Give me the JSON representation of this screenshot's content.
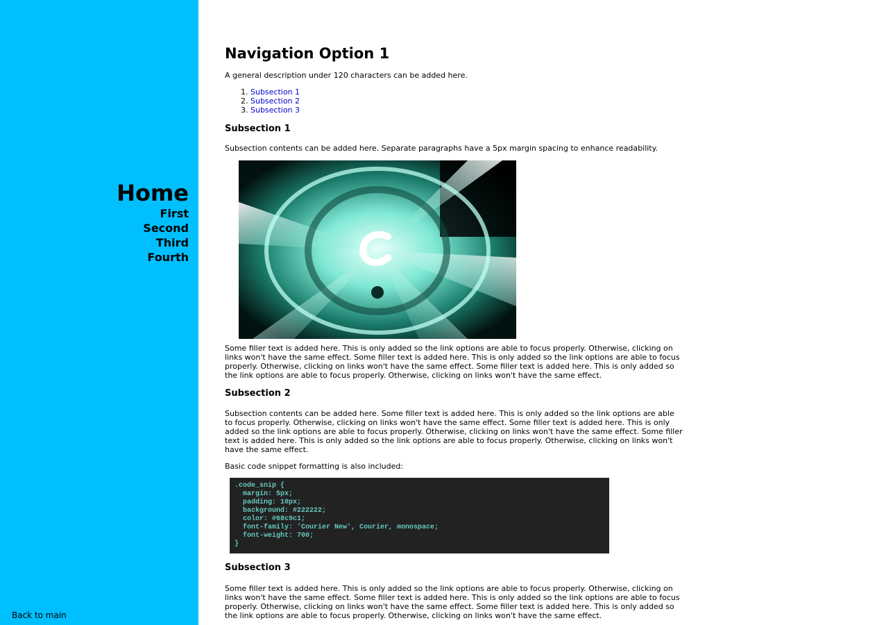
{
  "sidebar": {
    "home": "Home",
    "items": [
      "First",
      "Second",
      "Third",
      "Fourth"
    ],
    "back": "Back to main",
    "bg": "#00bfff"
  },
  "main": {
    "title": "Navigation Option 1",
    "description": "A general description under 120 characters can be added here.",
    "toc": [
      "Subsection 1",
      "Subsection 2",
      "Subsection 3"
    ],
    "sections": [
      {
        "heading": "Subsection 1",
        "intro": "Subsection contents can be added here. Separate paragraphs have a 5px margin spacing to enhance readability.",
        "filler": "Some filler text is added here. This is only added so the link options are able to focus properly. Otherwise, clicking on links won't have the same effect. Some filler text is added here. This is only added so the link options are able to focus properly. Otherwise, clicking on links won't have the same effect. Some filler text is added here. This is only added so the link options are able to focus properly. Otherwise, clicking on links won't have the same effect."
      },
      {
        "heading": "Subsection 2",
        "intro": "Subsection contents can be added here. Some filler text is added here. This is only added so the link options are able to focus properly. Otherwise, clicking on links won't have the same effect. Some filler text is added here. This is only added so the link options are able to focus properly. Otherwise, clicking on links won't have the same effect. Some filler text is added here. This is only added so the link options are able to focus properly. Otherwise, clicking on links won't have the same effect.",
        "code_label": "Basic code snippet formatting is also included:",
        "code": ".code_snip {\n  margin: 5px;\n  padding: 10px;\n  background: #222222;\n  color: #68c9c1;\n  font-family: 'Courier New', Courier, monospace;\n  font-weight: 700;\n}"
      },
      {
        "heading": "Subsection 3",
        "filler": "Some filler text is added here. This is only added so the link options are able to focus properly. Otherwise, clicking on links won't have the same effect. Some filler text is added here. This is only added so the link options are able to focus properly. Otherwise, clicking on links won't have the same effect. Some filler text is added here. This is only added so the link options are able to focus properly. Otherwise, clicking on links won't have the same effect."
      }
    ]
  },
  "colors": {
    "link": "#0000cc",
    "code_bg": "#222222",
    "code_fg": "#68c9c1"
  }
}
